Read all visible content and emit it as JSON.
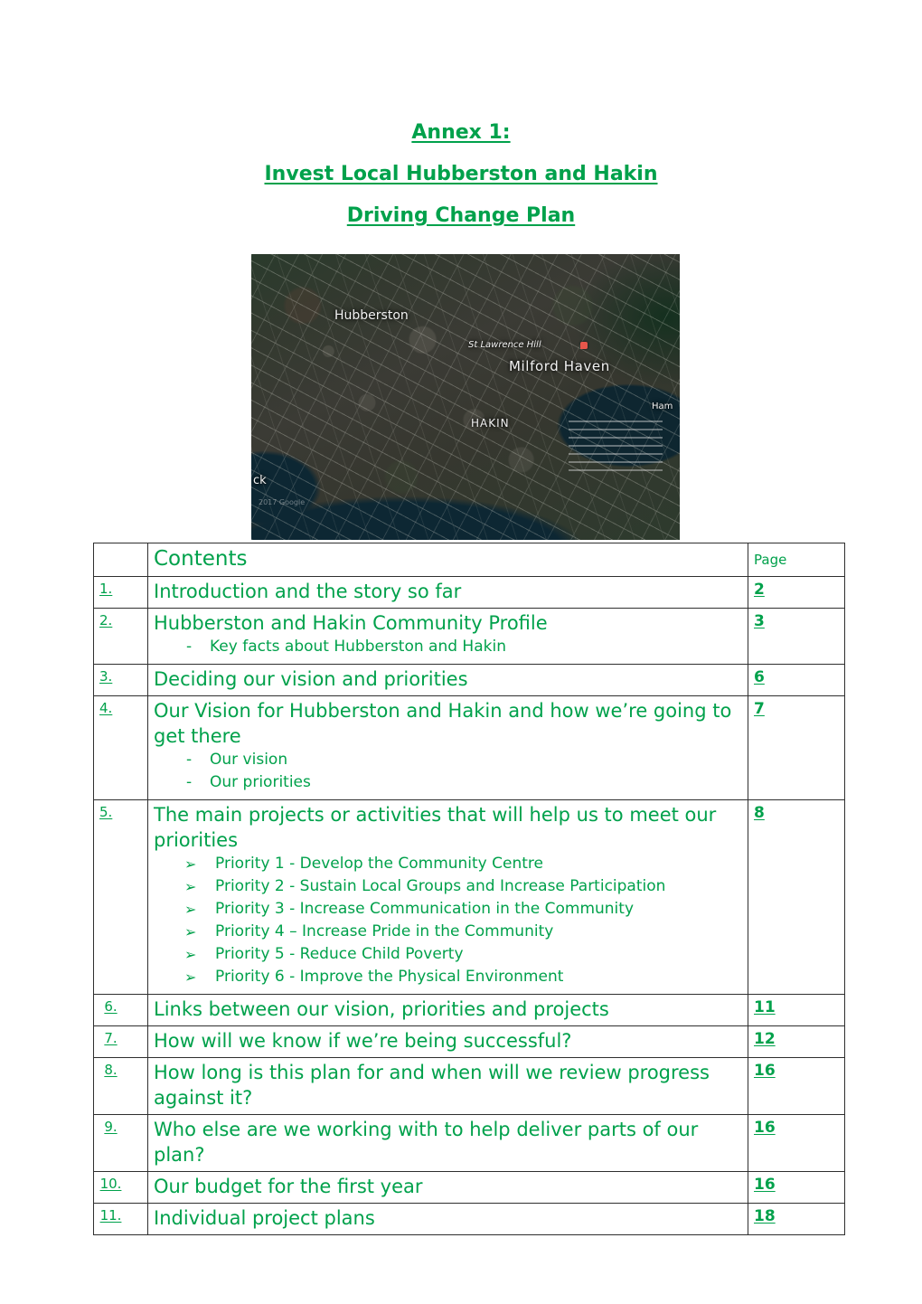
{
  "document": {
    "titles": [
      "Annex 1:",
      "Invest Local Hubberston and Hakin",
      "Driving Change Plan"
    ],
    "accent_color": "#00A14B",
    "border_color": "#2f2f2f"
  },
  "map": {
    "alt": "Satellite aerial photograph of Hubberston and Hakin, Milford Haven",
    "labels": {
      "hubberston": "Hubberston",
      "st_lawrence_hill": "St Lawrence Hill",
      "milford_haven": "Milford Haven",
      "hakin": "HAKIN",
      "partial_left": "ck",
      "partial_right": "Ham",
      "credit": "2017 Google"
    }
  },
  "contents": {
    "heading": "Contents",
    "page_header": "Page",
    "rows": [
      {
        "number": "1.",
        "title": "Introduction and the story so far",
        "page": "2",
        "sub": []
      },
      {
        "number": "2.",
        "title": "Hubberston and Hakin Community Profile",
        "page": "3",
        "sub_marker": "-",
        "sub": [
          "Key facts about Hubberston and Hakin"
        ]
      },
      {
        "number": "3.",
        "title": "Deciding our vision and priorities",
        "page": "6",
        "sub": []
      },
      {
        "number": "4.",
        "title": "Our Vision for Hubberston and Hakin and how we’re going to get there",
        "page": "7",
        "sub_marker": "-",
        "sub": [
          "Our vision",
          "Our priorities"
        ]
      },
      {
        "number": "5.",
        "title": "The main projects or activities that will help us to meet our priorities",
        "page": "8",
        "sub_marker": "➢",
        "sub": [
          "Priority 1 - Develop the Community Centre",
          "Priority 2 - Sustain Local Groups and Increase Participation",
          "Priority 3 - Increase Communication in the Community",
          "Priority 4 – Increase Pride in the Community",
          "Priority 5 - Reduce Child Poverty",
          "Priority 6 - Improve the Physical Environment"
        ]
      },
      {
        "number": "6.",
        "title": "Links between our vision, priorities and projects",
        "page": "11",
        "sub": []
      },
      {
        "number": "7.",
        "title": "How will we know if we’re being successful?",
        "page": "12",
        "sub": []
      },
      {
        "number": "8.",
        "title": "How long is this plan for and when will we review progress against it?",
        "page": "16",
        "sub": []
      },
      {
        "number": "9.",
        "title": "Who else are we working with to help deliver parts of our plan?",
        "page": "16",
        "sub": []
      },
      {
        "number": "10.",
        "title": "Our budget for the first year",
        "page": "16",
        "sub": []
      },
      {
        "number": "11.",
        "title": "Individual project plans",
        "page": "18",
        "sub": []
      }
    ]
  }
}
